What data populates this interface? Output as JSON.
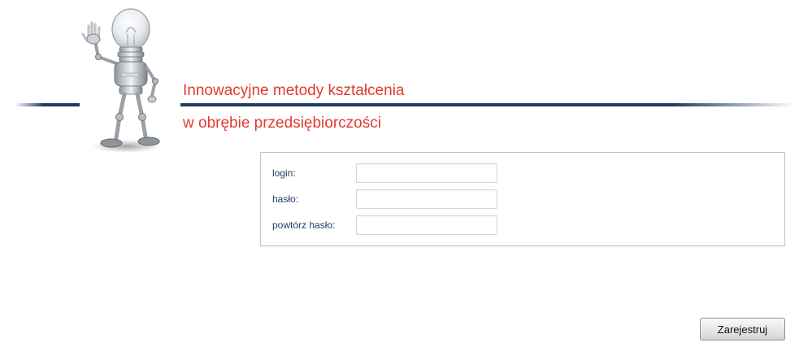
{
  "header": {
    "title_line1": "Innowacyjne metody kształcenia",
    "title_line2": "w obrębie przedsiębiorczości",
    "title_color": "#e23a2e",
    "line_color": "#1f3a5f",
    "mascot_icon": "lightbulb-robot-waving"
  },
  "form": {
    "fields": [
      {
        "label": "login:",
        "value": "",
        "placeholder": ""
      },
      {
        "label": "hasło:",
        "value": "",
        "placeholder": ""
      },
      {
        "label": "powtórz hasło:",
        "value": "",
        "placeholder": ""
      }
    ],
    "label_color": "#1f3a6b"
  },
  "actions": {
    "register_label": "Zarejestruj"
  }
}
